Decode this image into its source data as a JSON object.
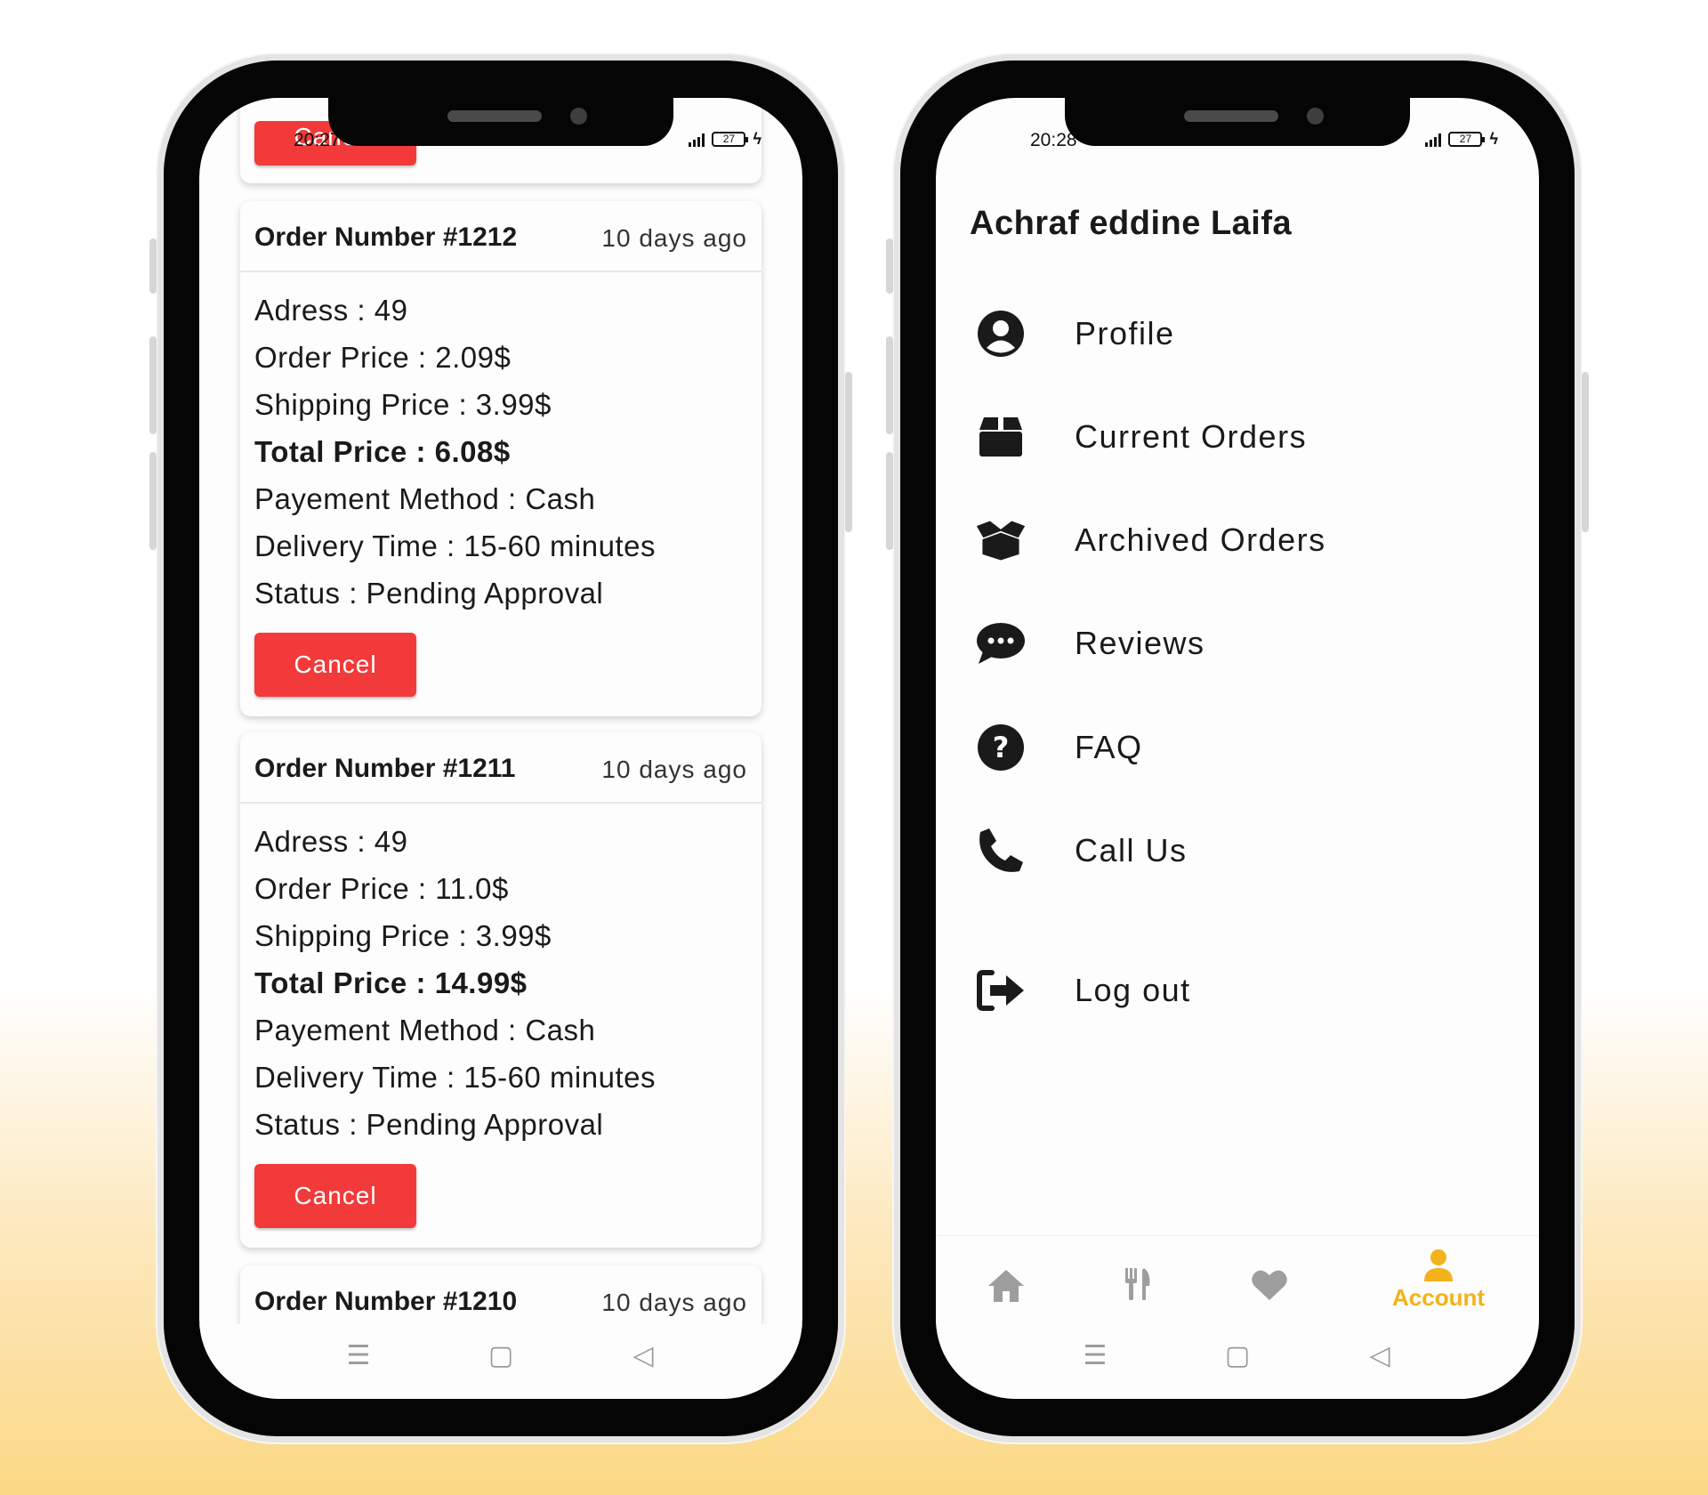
{
  "status_bar": {
    "left_time": "20:27",
    "right_time": "20:28",
    "battery": "27"
  },
  "orders_screen": {
    "partial_top_button": "Cancel",
    "orders": [
      {
        "number": "Order Number #1212",
        "date": "10 days ago",
        "address": "Adress : 49",
        "order_price": "Order Price : 2.09$",
        "shipping_price": "Shipping Price : 3.99$",
        "total_price": "Total Price : 6.08$",
        "payment": "Payement Method : Cash",
        "delivery": "Delivery Time : 15-60 minutes",
        "status": "Status : Pending Approval",
        "button": "Cancel"
      },
      {
        "number": "Order Number #1211",
        "date": "10 days ago",
        "address": "Adress : 49",
        "order_price": "Order Price : 11.0$",
        "shipping_price": "Shipping Price : 3.99$",
        "total_price": "Total Price : 14.99$",
        "payment": "Payement Method : Cash",
        "delivery": "Delivery Time : 15-60 minutes",
        "status": "Status : Pending Approval",
        "button": "Cancel"
      }
    ],
    "partial_bottom": {
      "number": "Order Number #1210",
      "date": "10 days ago"
    }
  },
  "account_screen": {
    "user_name": "Achraf eddine Laifa",
    "menu": [
      {
        "label": "Profile",
        "icon": "user-circle-icon"
      },
      {
        "label": "Current Orders",
        "icon": "box-icon"
      },
      {
        "label": "Archived Orders",
        "icon": "open-box-icon"
      },
      {
        "label": "Reviews",
        "icon": "chat-bubble-icon"
      },
      {
        "label": "FAQ",
        "icon": "question-circle-icon"
      },
      {
        "label": "Call Us",
        "icon": "phone-icon"
      },
      {
        "label": "Log out",
        "icon": "logout-icon"
      }
    ],
    "bottom_nav": {
      "tabs": [
        "home-icon",
        "restaurant-icon",
        "heart-icon",
        "account-icon"
      ],
      "active_label": "Account",
      "active_color": "#f3b21a",
      "inactive_color": "#9e9e9e"
    }
  },
  "colors": {
    "cancel_button": "#f23a3a",
    "background_gradient_end": "#fbd884"
  }
}
